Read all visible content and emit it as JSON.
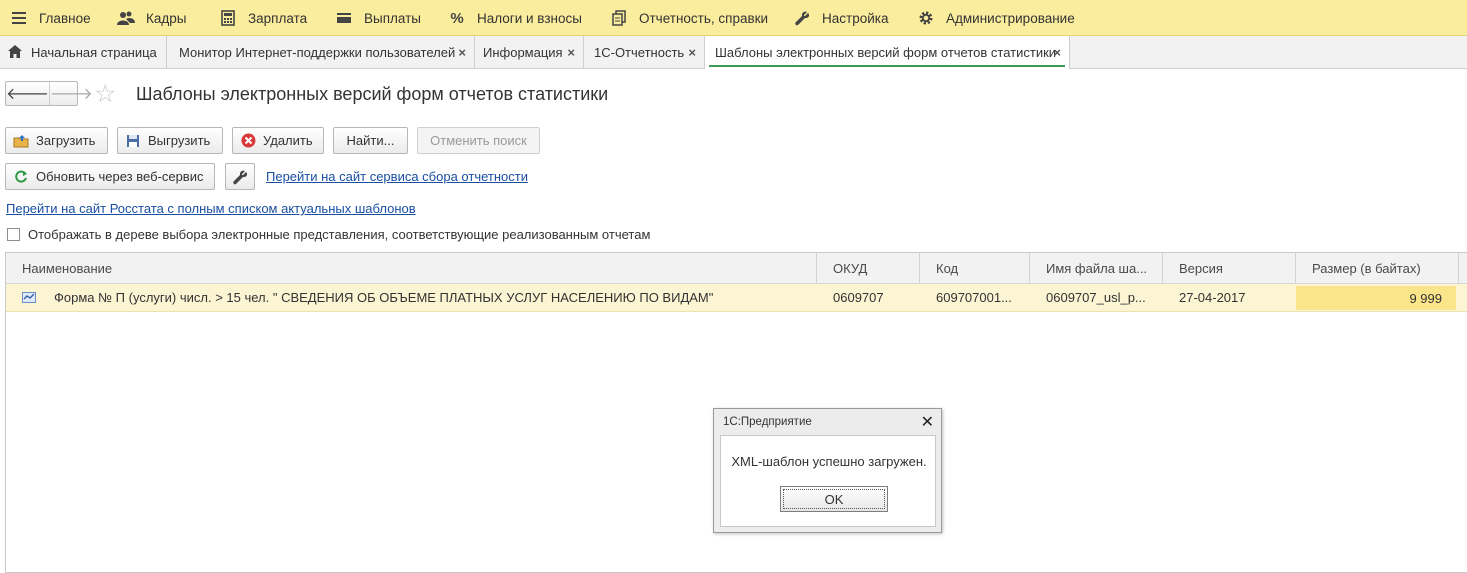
{
  "colors": {
    "menu_bg": "#fbed9e",
    "accent_green": "#3a9a56",
    "link": "#1a4fa3",
    "row_selected": "#fbf5d3",
    "cell_highlight": "#fbe58b"
  },
  "menu": {
    "items": [
      {
        "label": "Главное",
        "icon": "hamburger-icon"
      },
      {
        "label": "Кадры",
        "icon": "people-icon"
      },
      {
        "label": "Зарплата",
        "icon": "calculator-icon"
      },
      {
        "label": "Выплаты",
        "icon": "wallet-icon"
      },
      {
        "label": "Налоги и взносы",
        "icon": "percent-icon"
      },
      {
        "label": "Отчетность, справки",
        "icon": "documents-icon"
      },
      {
        "label": "Настройка",
        "icon": "wrench-icon"
      },
      {
        "label": "Администрирование",
        "icon": "gear-icon"
      }
    ]
  },
  "tabs": [
    {
      "label": "Начальная страница",
      "icon": "home-icon"
    },
    {
      "label": "Монитор Интернет-поддержки пользователей",
      "close": "×"
    },
    {
      "label": "Информация",
      "close": "×"
    },
    {
      "label": "1С-Отчетность",
      "close": "×"
    },
    {
      "label": "Шаблоны электронных версий форм отчетов статистики",
      "close": "×",
      "active": true
    }
  ],
  "nav": {
    "back": "🡐",
    "forward": "🡒",
    "star": "☆"
  },
  "page": {
    "title": "Шаблоны электронных версий форм отчетов статистики"
  },
  "toolbar": {
    "load": "Загрузить",
    "unload": "Выгрузить",
    "delete": "Удалить",
    "find": "Найти...",
    "cancel_search": "Отменить поиск",
    "refresh": "Обновить через веб-сервис",
    "service_link": "Перейти на сайт сервиса сбора отчетности"
  },
  "rosstat_link": "Перейти на сайт Росстата с полным списком актуальных шаблонов",
  "checkbox": {
    "label": "Отображать в дереве выбора электронные представления, соответствующие реализованным отчетам",
    "checked": false
  },
  "table": {
    "columns": [
      "Наименование",
      "ОКУД",
      "Код",
      "Имя файла ша...",
      "Версия",
      "Размер (в байтах)"
    ],
    "rows": [
      {
        "name": "Форма № П (услуги) числ. > 15 чел.  \" СВЕДЕНИЯ ОБ ОБЪЕМЕ ПЛАТНЫХ УСЛУГ НАСЕЛЕНИЮ ПО ВИДАМ\"",
        "okud": "0609707",
        "code": "609707001...",
        "filename": "0609707_usl_p...",
        "version": "27-04-2017",
        "size": "9 999"
      }
    ]
  },
  "dialog": {
    "title": "1С:Предприятие",
    "close": "✕",
    "message": "XML-шаблон успешно загружен.",
    "ok": "OK"
  }
}
